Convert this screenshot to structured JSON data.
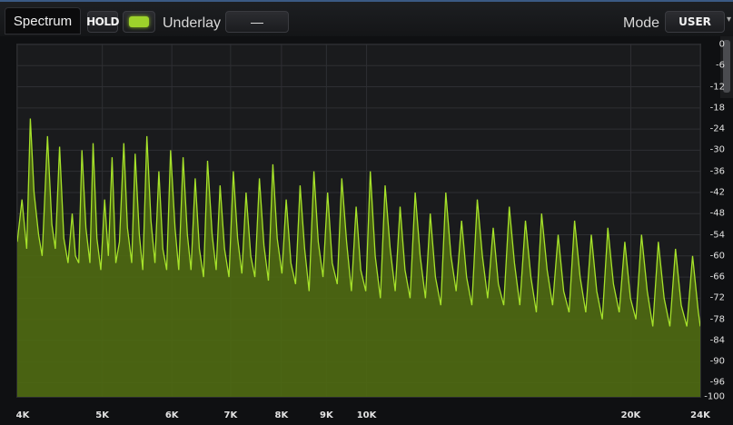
{
  "toolbar": {
    "tab_label": "Spectrum",
    "hold_label": "HOLD",
    "underlay_label": "Underlay",
    "underlay_value": "—",
    "mode_label": "Mode",
    "mode_value": "USER"
  },
  "colors": {
    "spectrum_line": "#a6e22a",
    "spectrum_fill": "#4f6a12",
    "accent": "#9dd22b",
    "grid": "#2e2f33"
  },
  "chart_data": {
    "type": "area",
    "xscale": "log",
    "xlim": [
      4000,
      24000
    ],
    "ylim": [
      -100,
      0
    ],
    "x_tick_labels": [
      "4K",
      "5K",
      "6K",
      "7K",
      "8K",
      "9K",
      "10K",
      "20K",
      "24K"
    ],
    "x_tick_values": [
      4000,
      5000,
      6000,
      7000,
      8000,
      9000,
      10000,
      20000,
      24000
    ],
    "y_tick_labels": [
      "0",
      "-6",
      "-12",
      "-18",
      "-24",
      "-30",
      "-36",
      "-42",
      "-48",
      "-54",
      "-60",
      "-66",
      "-72",
      "-78",
      "-84",
      "-90",
      "-96",
      "-100"
    ],
    "y_tick_values": [
      0,
      -6,
      -12,
      -18,
      -24,
      -30,
      -36,
      -42,
      -48,
      -54,
      -60,
      -66,
      -72,
      -78,
      -84,
      -90,
      -96,
      -100
    ],
    "series": [
      {
        "x": [
          4000,
          4050,
          4100,
          4140,
          4180,
          4230,
          4270,
          4330,
          4380,
          4420,
          4470,
          4520,
          4570,
          4620,
          4660,
          4700,
          4740,
          4790,
          4840,
          4880,
          4930,
          4980,
          5030,
          5080,
          5130,
          5180,
          5230,
          5290,
          5340,
          5400,
          5450,
          5510,
          5560,
          5620,
          5680,
          5740,
          5800,
          5860,
          5920,
          5980,
          6050,
          6110,
          6180,
          6250,
          6310,
          6380,
          6450,
          6520,
          6590,
          6670,
          6740,
          6810,
          6890,
          6970,
          7050,
          7130,
          7210,
          7290,
          7380,
          7460,
          7550,
          7640,
          7730,
          7820,
          7910,
          8010,
          8100,
          8200,
          8300,
          8400,
          8500,
          8600,
          8710,
          8810,
          8920,
          9030,
          9140,
          9260,
          9370,
          9490,
          9610,
          9730,
          9850,
          9980,
          10100,
          10230,
          10370,
          10500,
          10640,
          10780,
          10920,
          11060,
          11210,
          11360,
          11510,
          11670,
          11820,
          11980,
          12150,
          12310,
          12480,
          12650,
          12830,
          13000,
          13180,
          13370,
          13550,
          13740,
          13940,
          14130,
          14330,
          14540,
          14740,
          14950,
          15170,
          15390,
          15610,
          15830,
          16060,
          16290,
          16530,
          16770,
          17010,
          17260,
          17510,
          17770,
          18030,
          18290,
          18560,
          18830,
          19110,
          19400,
          19690,
          19980,
          20270,
          20570,
          20880,
          21190,
          21500,
          21830,
          22160,
          22490,
          22830,
          23170,
          23520,
          23880,
          24000
        ],
        "y": [
          -56,
          -44,
          -58,
          -21,
          -42,
          -54,
          -60,
          -26,
          -51,
          -58,
          -29,
          -55,
          -62,
          -48,
          -60,
          -62,
          -30,
          -52,
          -62,
          -28,
          -55,
          -64,
          -44,
          -60,
          -32,
          -62,
          -56,
          -28,
          -52,
          -62,
          -31,
          -54,
          -64,
          -26,
          -50,
          -62,
          -36,
          -58,
          -64,
          -30,
          -52,
          -64,
          -32,
          -54,
          -64,
          -38,
          -58,
          -66,
          -33,
          -54,
          -64,
          -40,
          -58,
          -66,
          -36,
          -55,
          -65,
          -42,
          -60,
          -66,
          -38,
          -57,
          -67,
          -34,
          -55,
          -65,
          -44,
          -62,
          -68,
          -40,
          -58,
          -70,
          -36,
          -56,
          -66,
          -42,
          -62,
          -68,
          -38,
          -56,
          -70,
          -46,
          -64,
          -70,
          -36,
          -60,
          -72,
          -40,
          -58,
          -70,
          -46,
          -64,
          -72,
          -42,
          -60,
          -72,
          -48,
          -66,
          -74,
          -42,
          -60,
          -70,
          -50,
          -66,
          -74,
          -44,
          -60,
          -72,
          -52,
          -68,
          -74,
          -46,
          -62,
          -74,
          -50,
          -66,
          -76,
          -48,
          -64,
          -74,
          -54,
          -70,
          -76,
          -50,
          -66,
          -76,
          -54,
          -70,
          -78,
          -52,
          -68,
          -76,
          -56,
          -72,
          -78,
          -54,
          -70,
          -80,
          -56,
          -72,
          -80,
          -58,
          -74,
          -80,
          -60,
          -76,
          -80
        ]
      }
    ]
  }
}
